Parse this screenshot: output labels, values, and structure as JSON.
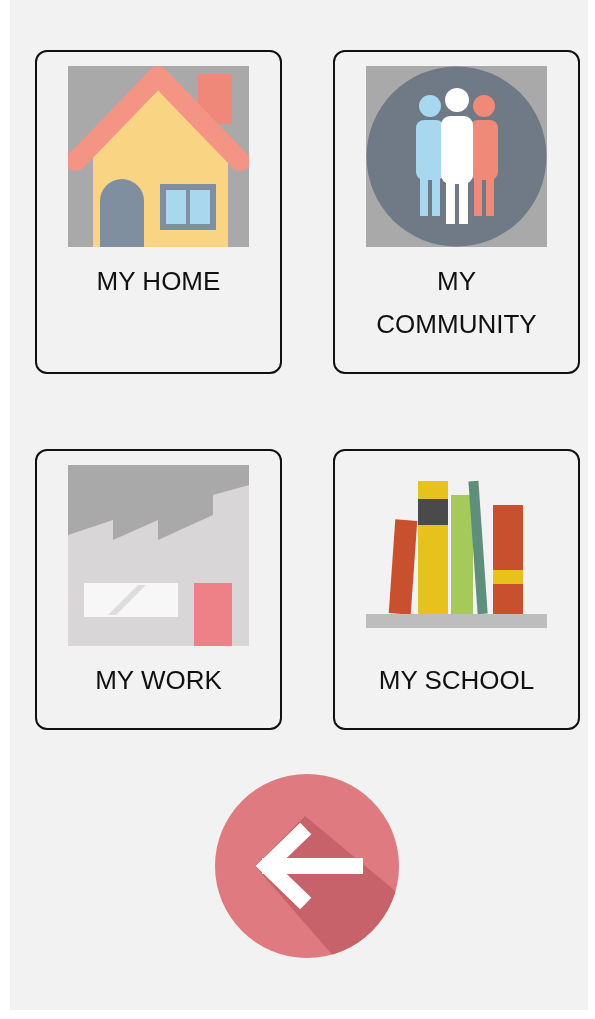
{
  "tiles": [
    {
      "kind": "home",
      "label": "MY HOME"
    },
    {
      "kind": "community",
      "label": "MY COMMUNITY"
    },
    {
      "kind": "work",
      "label": "MY WORK"
    },
    {
      "kind": "school",
      "label": "MY SCHOOL"
    }
  ],
  "back_button": {
    "kind": "back"
  }
}
